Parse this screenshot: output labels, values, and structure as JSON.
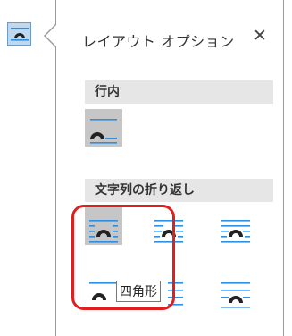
{
  "panel": {
    "title": "レイアウト オプション",
    "close_symbol": "✕"
  },
  "sections": {
    "inline": "行内",
    "wrap": "文字列の折り返し"
  },
  "tooltip": "四角形",
  "colors": {
    "accent_blue": "#2e8ee0",
    "arch_dark": "#222222",
    "selected_bg": "#c6c6c6",
    "section_bg": "#e6e6e6",
    "highlight_red": "#e0201f"
  }
}
